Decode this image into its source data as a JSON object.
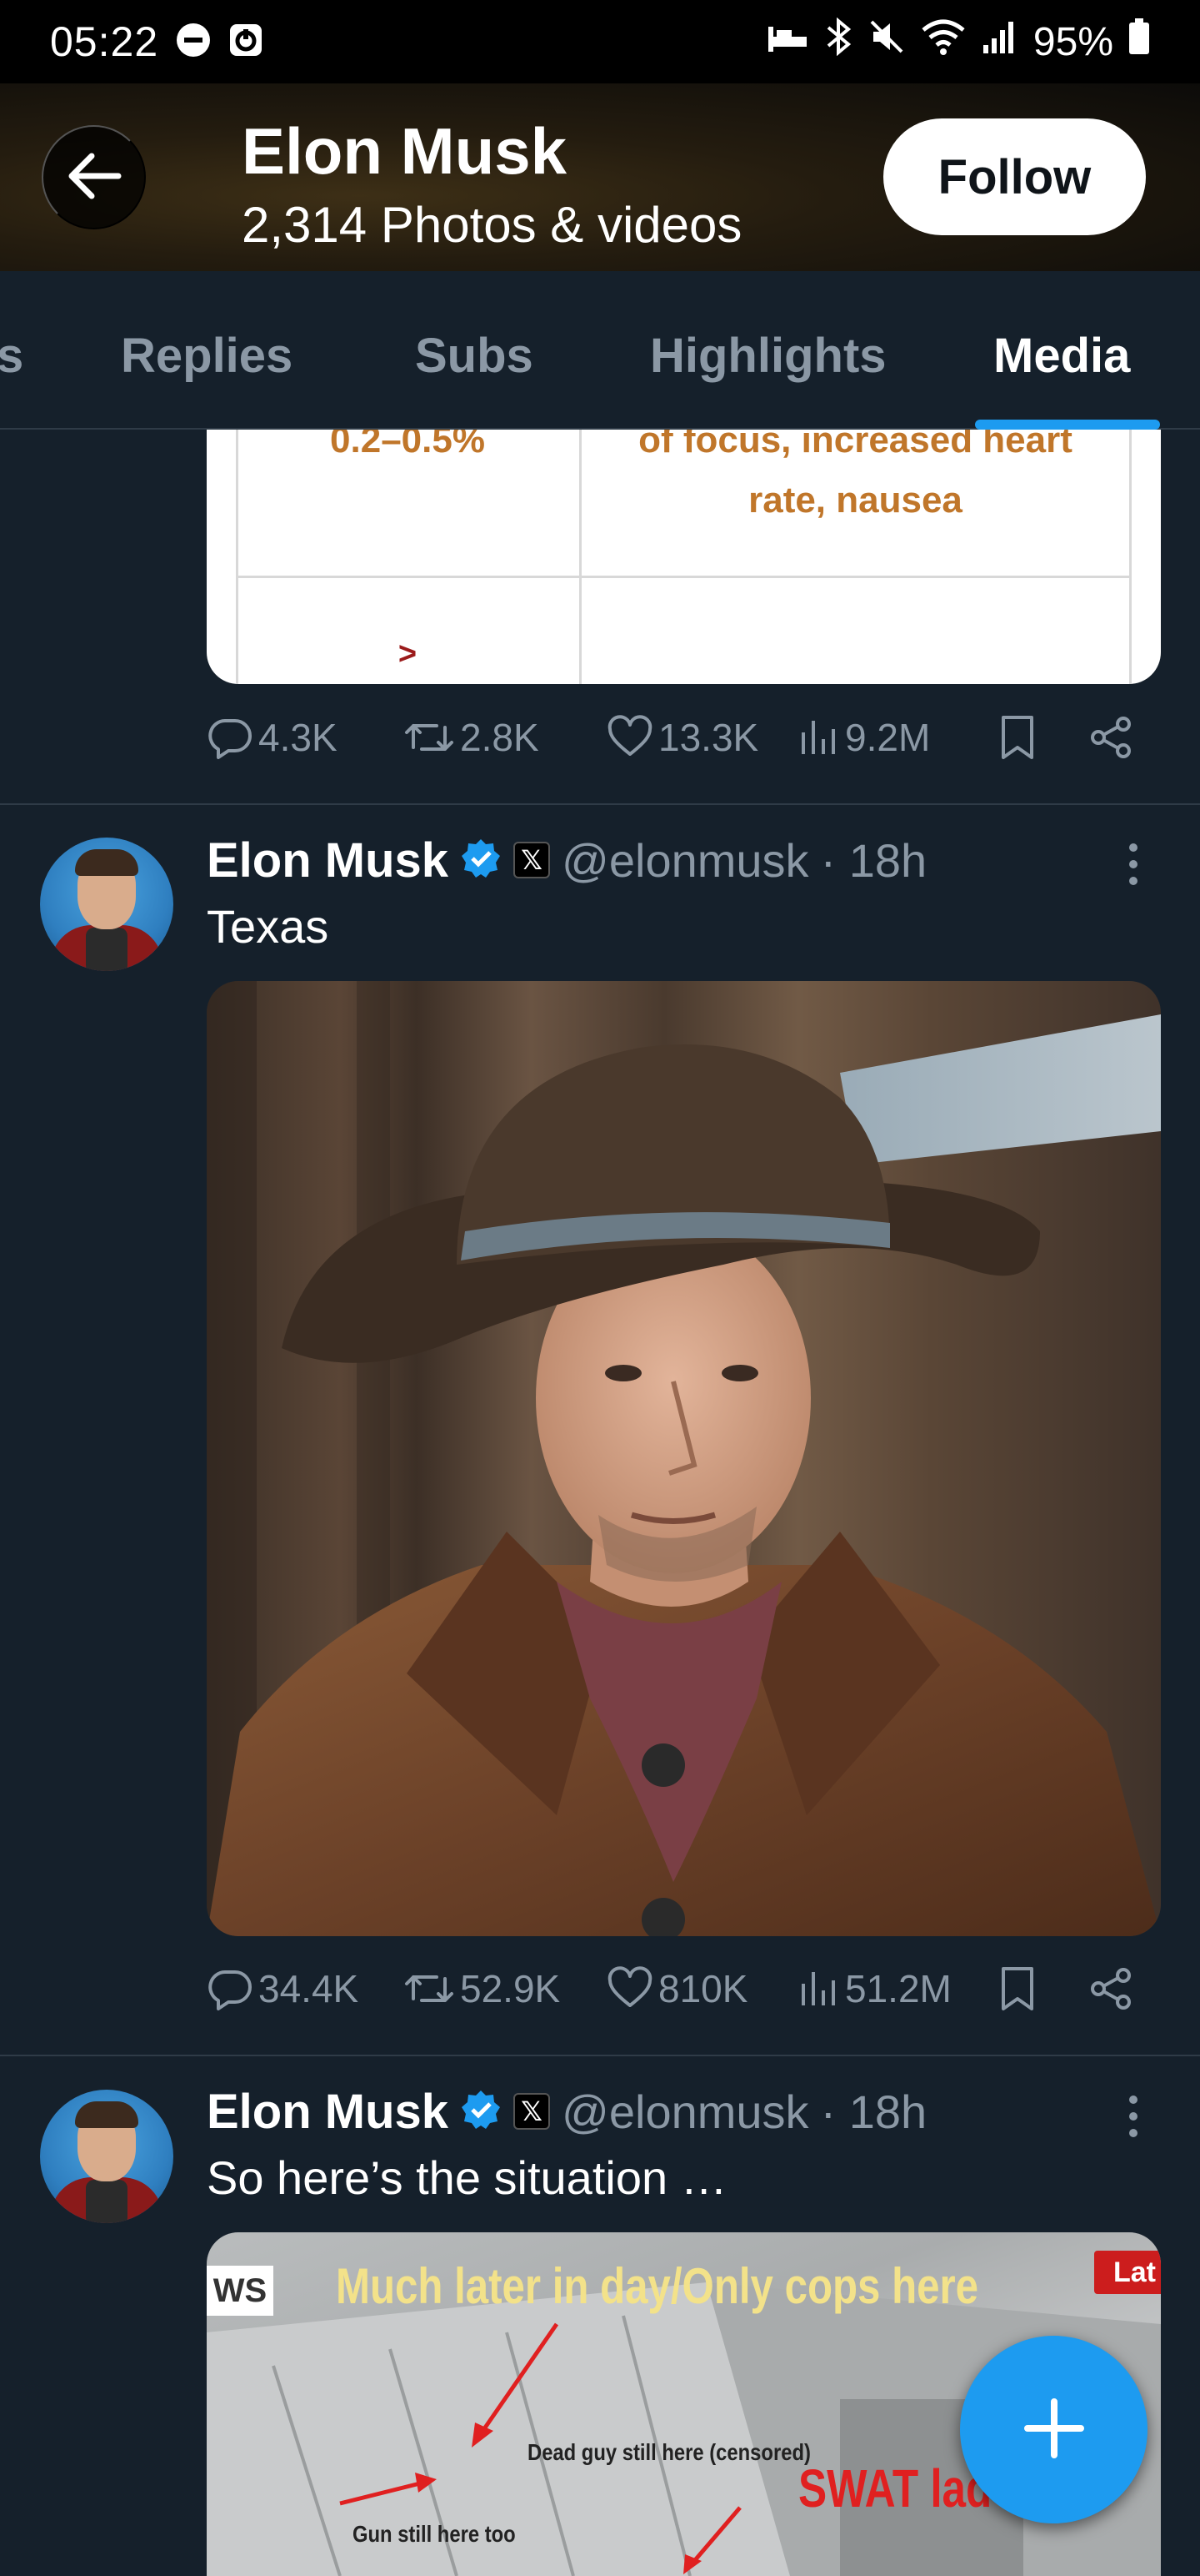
{
  "status_bar": {
    "time": "05:22",
    "battery": "95%"
  },
  "header": {
    "name": "Elon Musk",
    "subtitle": "2,314 Photos & videos",
    "follow_label": "Follow"
  },
  "tabs": [
    {
      "label": "s",
      "active": false
    },
    {
      "label": "Replies",
      "active": false
    },
    {
      "label": "Subs",
      "active": false
    },
    {
      "label": "Highlights",
      "active": false
    },
    {
      "label": "Media",
      "active": true
    }
  ],
  "table_snippet": {
    "cell_left_top": "0.2–0.5%",
    "cell_right_top_1": "of focus, increased heart",
    "cell_right_top_2": "rate, nausea",
    "cell_left_bottom": ">"
  },
  "posts": [
    {
      "stats": {
        "replies": "4.3K",
        "reposts": "2.8K",
        "likes": "13.3K",
        "views": "9.2M"
      }
    },
    {
      "name": "Elon Musk",
      "handle": "@elonmusk",
      "time": "· 18h",
      "text": "Texas",
      "stats": {
        "replies": "34.4K",
        "reposts": "52.9K",
        "likes": "810K",
        "views": "51.2M"
      }
    },
    {
      "name": "Elon Musk",
      "handle": "@elonmusk",
      "time": "· 18h",
      "text": "So here’s the situation …",
      "media": {
        "ws": "WS",
        "caption": "Much later in day/Only cops here",
        "lat": "Lat",
        "label_dead": "Dead guy still here (censored)",
        "label_gun": "Gun still here too",
        "label_swat": "SWAT lad"
      }
    }
  ],
  "colors": {
    "background": "#15202b",
    "accent": "#1d9bf0",
    "muted": "#8b98a5",
    "divider": "#2f3b47"
  },
  "icons": [
    "back-arrow-icon",
    "reply-icon",
    "repost-icon",
    "like-icon",
    "views-icon",
    "bookmark-icon",
    "share-icon",
    "verified-icon",
    "x-badge-icon",
    "more-icon",
    "compose-plus-icon"
  ]
}
